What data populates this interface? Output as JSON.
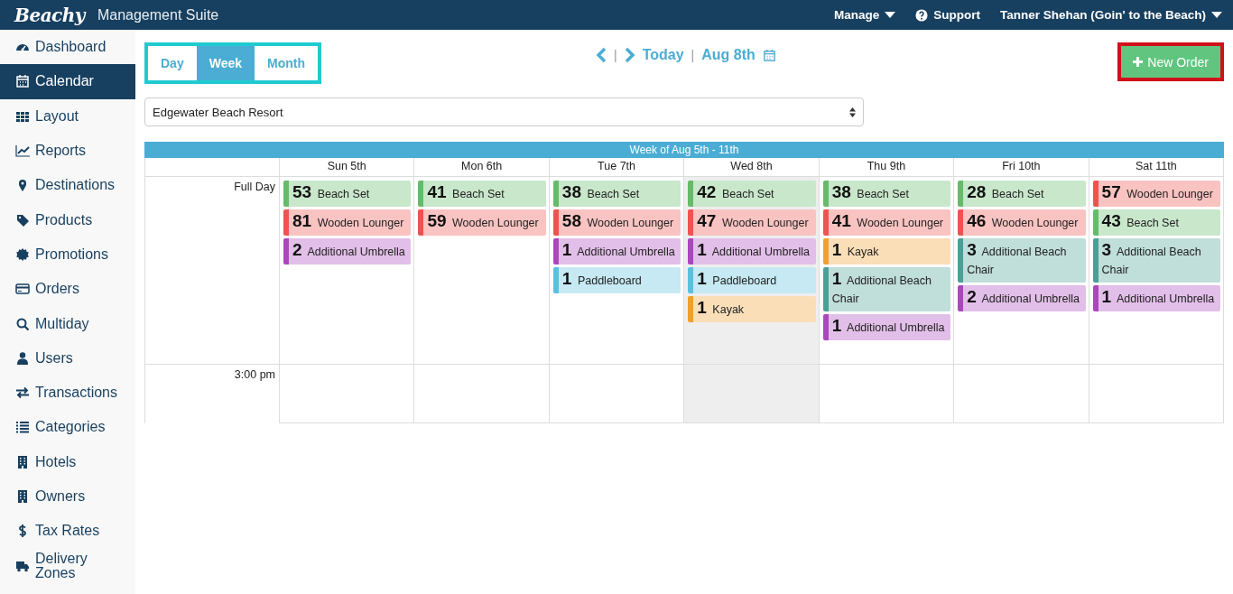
{
  "header": {
    "logo": "Beachy",
    "title": "Management Suite",
    "menu": [
      {
        "label": "Manage",
        "kind": "dropdown"
      },
      {
        "label": "Support",
        "kind": "help"
      },
      {
        "label": "Tanner Shehan (Goin' to the Beach)",
        "kind": "dropdown"
      }
    ]
  },
  "sidebar": {
    "items": [
      {
        "label": "Dashboard",
        "selected": false
      },
      {
        "label": "Calendar",
        "selected": true
      },
      {
        "label": "Layout",
        "selected": false
      },
      {
        "label": "Reports",
        "selected": false
      },
      {
        "label": "Destinations",
        "selected": false
      },
      {
        "label": "Products",
        "selected": false
      },
      {
        "label": "Promotions",
        "selected": false
      },
      {
        "label": "Orders",
        "selected": false
      },
      {
        "label": "Multiday",
        "selected": false
      },
      {
        "label": "Users",
        "selected": false
      },
      {
        "label": "Transactions",
        "selected": false
      },
      {
        "label": "Categories",
        "selected": false
      },
      {
        "label": "Hotels",
        "selected": false
      },
      {
        "label": "Owners",
        "selected": false
      },
      {
        "label": "Tax Rates",
        "selected": false
      },
      {
        "label": "Delivery Zones",
        "selected": false
      }
    ]
  },
  "view_switch": [
    {
      "label": "Day",
      "selected": false
    },
    {
      "label": "Week",
      "selected": true
    },
    {
      "label": "Month",
      "selected": false
    }
  ],
  "nav": {
    "separator_1": "|",
    "today": "Today",
    "separator_2": "|",
    "date": "Aug 8th"
  },
  "new_order_button": "New Order",
  "location_select": {
    "value": "Edgewater Beach Resort"
  },
  "calendar": {
    "week_title": "Week of Aug 5th - 11th",
    "rows": [
      "Full Day",
      "3:00 pm"
    ],
    "days": [
      {
        "label": "Sun 5th",
        "today": false,
        "events": [
          {
            "count": "53",
            "label": "Beach Set",
            "color": "#66bb6a"
          },
          {
            "count": "81",
            "label": "Wooden Lounger",
            "color": "#ef5350"
          },
          {
            "count": "2",
            "label": "Additional Umbrella",
            "color": "#ab47bc"
          }
        ]
      },
      {
        "label": "Mon 6th",
        "today": false,
        "events": [
          {
            "count": "41",
            "label": "Beach Set",
            "color": "#66bb6a"
          },
          {
            "count": "59",
            "label": "Wooden Lounger",
            "color": "#ef5350"
          }
        ]
      },
      {
        "label": "Tue 7th",
        "today": false,
        "events": [
          {
            "count": "38",
            "label": "Beach Set",
            "color": "#66bb6a"
          },
          {
            "count": "58",
            "label": "Wooden Lounger",
            "color": "#ef5350"
          },
          {
            "count": "1",
            "label": "Additional Umbrella",
            "color": "#ab47bc"
          },
          {
            "count": "1",
            "label": "Paddleboard",
            "color": "#5bc0de"
          }
        ]
      },
      {
        "label": "Wed 8th",
        "today": true,
        "events": [
          {
            "count": "42",
            "label": "Beach Set",
            "color": "#66bb6a"
          },
          {
            "count": "47",
            "label": "Wooden Lounger",
            "color": "#ef5350"
          },
          {
            "count": "1",
            "label": "Additional Umbrella",
            "color": "#ab47bc"
          },
          {
            "count": "1",
            "label": "Paddleboard",
            "color": "#5bc0de"
          },
          {
            "count": "1",
            "label": "Kayak",
            "color": "#f0a030"
          }
        ]
      },
      {
        "label": "Thu 9th",
        "today": false,
        "events": [
          {
            "count": "38",
            "label": "Beach Set",
            "color": "#66bb6a"
          },
          {
            "count": "41",
            "label": "Wooden Lounger",
            "color": "#ef5350"
          },
          {
            "count": "1",
            "label": "Kayak",
            "color": "#f0a030"
          },
          {
            "count": "1",
            "label": "Additional Beach Chair",
            "color": "#4aa096"
          },
          {
            "count": "1",
            "label": "Additional Umbrella",
            "color": "#ab47bc"
          }
        ]
      },
      {
        "label": "Fri 10th",
        "today": false,
        "events": [
          {
            "count": "28",
            "label": "Beach Set",
            "color": "#66bb6a"
          },
          {
            "count": "46",
            "label": "Wooden Lounger",
            "color": "#ef5350"
          },
          {
            "count": "3",
            "label": "Additional Beach Chair",
            "color": "#4aa096"
          },
          {
            "count": "2",
            "label": "Additional Umbrella",
            "color": "#ab47bc"
          }
        ]
      },
      {
        "label": "Sat 11th",
        "today": false,
        "events": [
          {
            "count": "57",
            "label": "Wooden Lounger",
            "color": "#ef5350"
          },
          {
            "count": "43",
            "label": "Beach Set",
            "color": "#66bb6a"
          },
          {
            "count": "3",
            "label": "Additional Beach Chair",
            "color": "#4aa096"
          },
          {
            "count": "1",
            "label": "Additional Umbrella",
            "color": "#ab47bc"
          }
        ]
      }
    ]
  }
}
